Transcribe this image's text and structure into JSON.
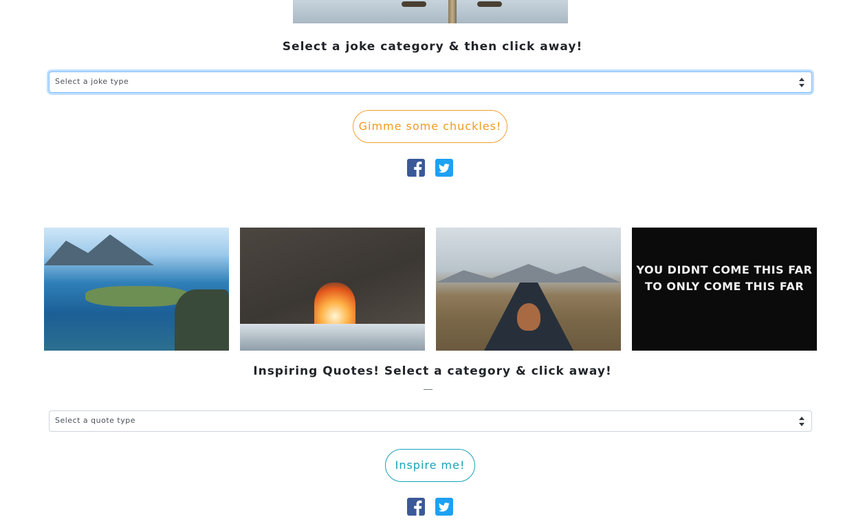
{
  "joke_section": {
    "heading": "Select a joke category & then click away!",
    "select_value": "Select a joke type",
    "button_label": "Gimme some chuckles!"
  },
  "gallery": {
    "images": [
      {
        "name": "lofoten-hikers-photo"
      },
      {
        "name": "sea-arch-sunset-photo"
      },
      {
        "name": "hot-spring-bather-photo"
      },
      {
        "name": "motivational-sign-photo",
        "text": "YOU DIDNT COME THIS FAR TO ONLY COME THIS FAR"
      }
    ]
  },
  "quote_section": {
    "heading": "Inspiring Quotes! Select a category & click away!",
    "select_value": "Select a quote type",
    "button_label": "Inspire me!"
  },
  "social": {
    "facebook_icon": "facebook-square-icon",
    "twitter_icon": "twitter-square-icon",
    "facebook_color": "#3b5998",
    "twitter_color": "#1da1f2"
  },
  "colors": {
    "joke_button": "#f09a20",
    "quote_button": "#17a2b8"
  }
}
